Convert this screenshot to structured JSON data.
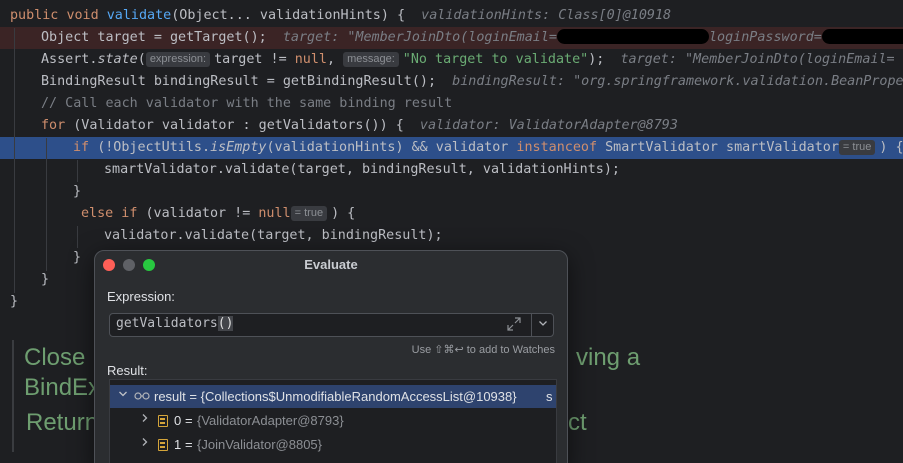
{
  "code_lines": {
    "l0": {
      "a": "public ",
      "b": "void ",
      "c": "validate",
      "d": "(Object... validationHints) {",
      "inline": "validationHints: Class[0]@10918"
    },
    "l1": {
      "a": "Object target = getTarget();",
      "inline_pre": "target: \"MemberJoinDto(loginEmail=",
      "inline_mid": "loginPassword="
    },
    "l2": {
      "a": "Assert.",
      "b": "state",
      "c": "(",
      "hint1": "expression:",
      "d": "target != ",
      "e": "null",
      "f": ", ",
      "hint2": "message:",
      "g": "\"No target to validate\"",
      "h": ");",
      "inline": "target: \"MemberJoinDto(loginEmail="
    },
    "l3": {
      "a": "BindingResult bindingResult = getBindingResult();",
      "inline": "bindingResult: \"org.springframework.validation.BeanPropertyBindingResult"
    },
    "l4": {
      "a": "// Call each validator with the same binding result"
    },
    "l5": {
      "a": "for ",
      "b": "(Validator validator : getValidators()) {",
      "inline": "validator: ValidatorAdapter@8793"
    },
    "l6": {
      "a": "if ",
      "b": "(!ObjectUtils.",
      "c": "isEmpty",
      "d": "(validationHints) && validator ",
      "e": "instanceof ",
      "f": "SmartValidator smartValidator",
      "hint": "= true",
      "g": ") {"
    },
    "l7": {
      "a": "smartValidator.validate(target, bindingResult, validationHints);"
    },
    "l8": {
      "a": "}"
    },
    "l9": {
      "a": "else if ",
      "b": "(validator != ",
      "c": "null",
      "hint": "= true",
      "d": ") {"
    },
    "l10": {
      "a": "validator.validate(target, bindingResult);"
    },
    "l11": {
      "a": "}"
    },
    "l12": {
      "a": "}"
    },
    "l13": {
      "a": "}"
    }
  },
  "background_doc": {
    "line1_left": "Close",
    "line1_right": "ving a",
    "line2_left": "BindEx",
    "line3_left": "Return",
    "line3_right": "ct"
  },
  "evaluate_dialog": {
    "title": "Evaluate",
    "expression_label": "Expression:",
    "expression_name": "getValidators",
    "expression_parens": "()",
    "watch_hint": "Use ⇧⌘↩ to add to Watches",
    "result_label": "Result:",
    "result_root": "result = {Collections$UnmodifiableRandomAccessList@10938}",
    "result_root_trail": "s",
    "items": [
      {
        "index": "0",
        "value": "{ValidatorAdapter@8793}"
      },
      {
        "index": "1",
        "value": "{JoinValidator@8805}"
      }
    ]
  },
  "colors": {
    "breakpoint_line": "#3b2425",
    "execution_line": "#2d4f8a",
    "selected_result": "#2e436e",
    "close_button": "#ff5f57",
    "minimize_button": "#5f6166",
    "zoom_button": "#28c840"
  }
}
